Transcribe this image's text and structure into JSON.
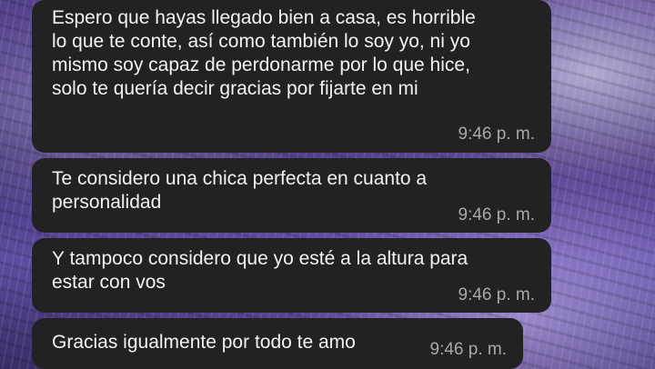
{
  "messages": [
    {
      "text": "Espero que hayas llegado bien a casa, es horrible\nlo que te conte, así como también lo soy yo, ni yo\nmismo soy capaz de perdonarme por lo que hice,\nsolo te quería decir gracias por fijarte en mi",
      "time": "9:46 p. m."
    },
    {
      "text": "Te considero una chica perfecta en cuanto a\npersonalidad",
      "time": "9:46 p. m."
    },
    {
      "text": "Y tampoco considero que yo esté a la altura para\nestar con vos",
      "time": "9:46 p. m."
    },
    {
      "text": "Gracias igualmente por todo te amo",
      "time": "9:46 p. m."
    }
  ]
}
